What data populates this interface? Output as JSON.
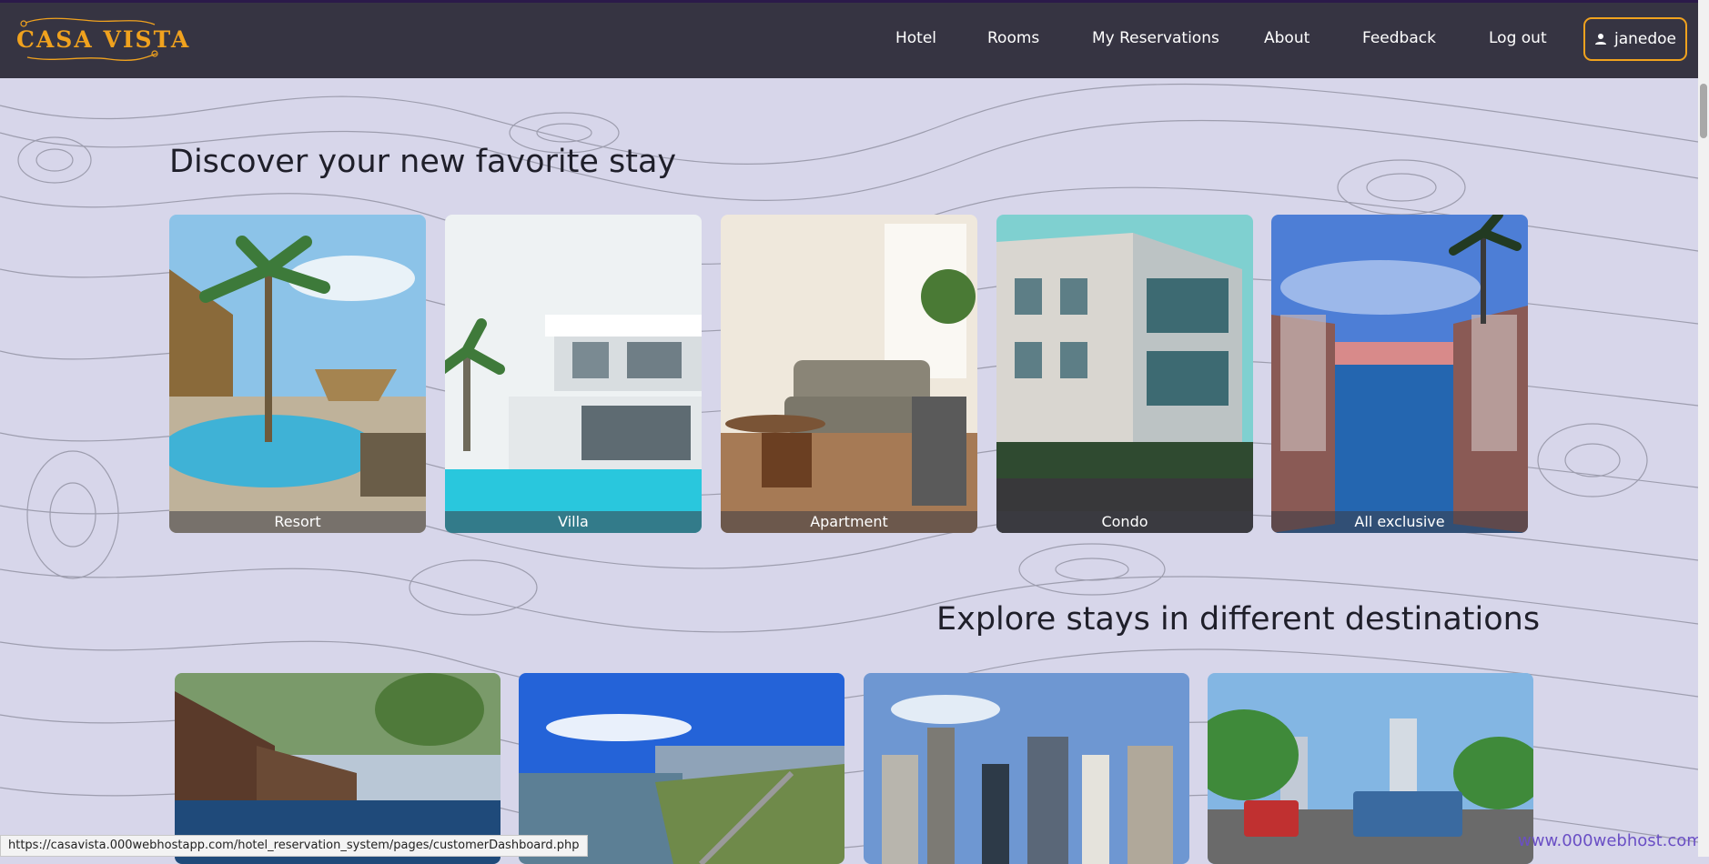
{
  "brand": {
    "name": "CASA VISTA",
    "accent": "#f0a21e"
  },
  "nav": {
    "hotel": "Hotel",
    "rooms": "Rooms",
    "reservations": "My Reservations",
    "about": "About",
    "feedback": "Feedback",
    "logout": "Log out",
    "user": "janedoe",
    "user_icon": "user-icon"
  },
  "discover": {
    "title": "Discover your new favorite stay",
    "cards": [
      "Resort",
      "Villa",
      "Apartment",
      "Condo",
      "All exclusive"
    ]
  },
  "explore": {
    "title": "Explore stays in different destinations"
  },
  "status_bar": {
    "url": "https://casavista.000webhostapp.com/hotel_reservation_system/pages/customerDashboard.php"
  },
  "watermark": "www.000webhost.com",
  "colors": {
    "header_bg": "#363442",
    "page_bg": "#d7d6ea"
  }
}
